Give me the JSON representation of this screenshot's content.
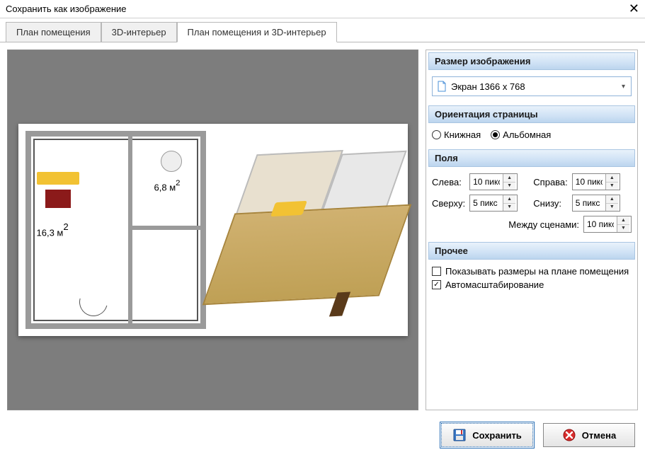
{
  "window": {
    "title": "Сохранить как изображение"
  },
  "tabs": [
    {
      "label": "План помещения"
    },
    {
      "label": "3D-интерьер"
    },
    {
      "label": "План помещения и 3D-интерьер"
    }
  ],
  "preview": {
    "area_label_1": "16,3 м",
    "area_label_2": "6,8 м",
    "area_unit_sup": "2"
  },
  "settings": {
    "image_size": {
      "heading": "Размер изображения",
      "preset": "Экран 1366 x 768"
    },
    "orientation": {
      "heading": "Ориентация страницы",
      "portrait": "Книжная",
      "landscape": "Альбомная",
      "selected": "landscape"
    },
    "margins": {
      "heading": "Поля",
      "left_label": "Слева:",
      "right_label": "Справа:",
      "top_label": "Сверху:",
      "bottom_label": "Снизу:",
      "between_label": "Между сценами:",
      "left": "10 пикс",
      "right": "10 пикс",
      "top": "5 пикс",
      "bottom": "5 пикс",
      "between": "10 пикс"
    },
    "other": {
      "heading": "Прочее",
      "show_dims": "Показывать размеры на плане помещения",
      "show_dims_checked": false,
      "autoscale": "Автомасштабирование",
      "autoscale_checked": true
    }
  },
  "footer": {
    "save": "Сохранить",
    "cancel": "Отмена"
  }
}
